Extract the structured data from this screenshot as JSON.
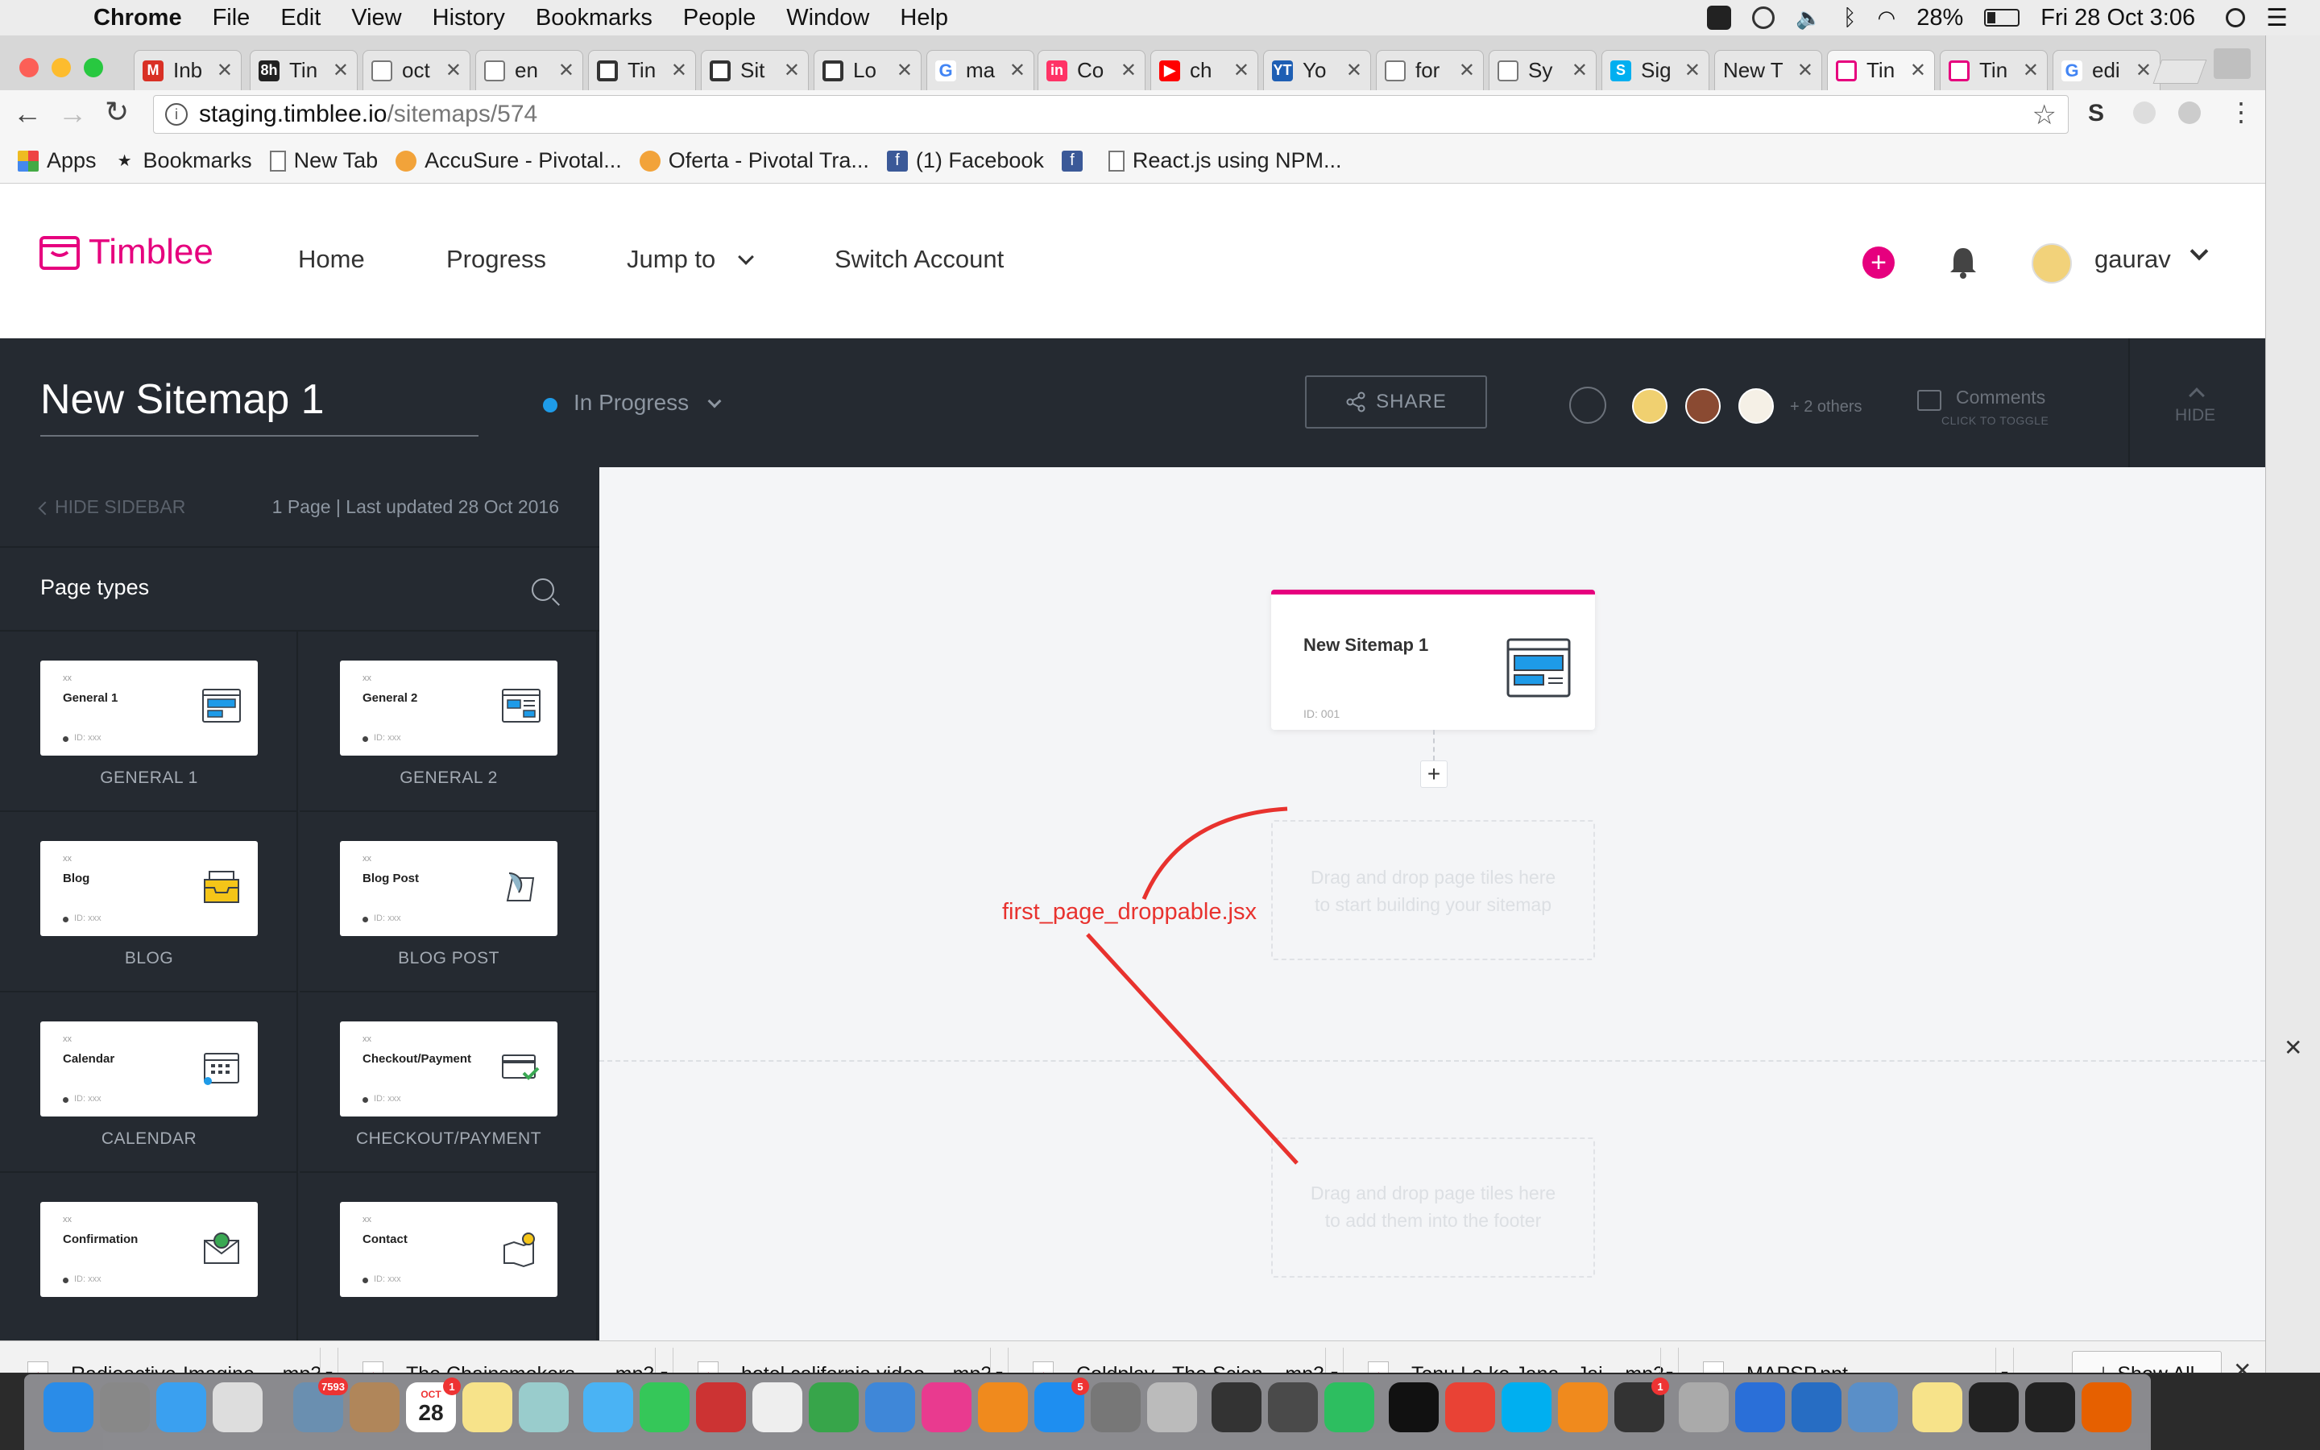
{
  "menubar": {
    "app": "Chrome",
    "items": [
      "File",
      "Edit",
      "View",
      "History",
      "Bookmarks",
      "People",
      "Window",
      "Help"
    ],
    "battery": "28%",
    "clock": "Fri 28 Oct  3:06"
  },
  "tabs": [
    {
      "label": "Inb",
      "icon": "gmail-icon",
      "color": "#d93025",
      "glyph": "M"
    },
    {
      "label": "Tin",
      "icon": "circle-badge-icon",
      "color": "#222222",
      "glyph": "8h"
    },
    {
      "label": "oct",
      "icon": "document-icon",
      "color": "#888888",
      "glyph": ""
    },
    {
      "label": "en",
      "icon": "document-icon",
      "color": "#888888",
      "glyph": ""
    },
    {
      "label": "Tin",
      "icon": "trello-icon",
      "color": "#333333",
      "glyph": ""
    },
    {
      "label": "Sit",
      "icon": "trello-icon",
      "color": "#333333",
      "glyph": ""
    },
    {
      "label": "Lo",
      "icon": "trello-icon",
      "color": "#333333",
      "glyph": ""
    },
    {
      "label": "ma",
      "icon": "google-icon",
      "color": "#4285f4",
      "glyph": "G"
    },
    {
      "label": "Co",
      "icon": "invision-icon",
      "color": "#ff3366",
      "glyph": "in"
    },
    {
      "label": "ch",
      "icon": "youtube-icon",
      "color": "#ff0000",
      "glyph": "▶"
    },
    {
      "label": "Yo",
      "icon": "ytmp3-icon",
      "color": "#1e5fb4",
      "glyph": "YT"
    },
    {
      "label": "for",
      "icon": "document-icon",
      "color": "#888888",
      "glyph": ""
    },
    {
      "label": "Sy",
      "icon": "document-icon",
      "color": "#888888",
      "glyph": ""
    },
    {
      "label": "Sig",
      "icon": "skype-icon",
      "color": "#00aff0",
      "glyph": "S"
    },
    {
      "label": "New T",
      "icon": "none",
      "color": "#e6e6e6",
      "glyph": ""
    },
    {
      "label": "Tin",
      "icon": "timblee-icon",
      "color": "#e6007e",
      "glyph": ""
    },
    {
      "label": "Tin",
      "icon": "timblee-icon",
      "color": "#e6007e",
      "glyph": ""
    },
    {
      "label": "edi",
      "icon": "google-icon",
      "color": "#4285f4",
      "glyph": "G"
    }
  ],
  "omnibox": {
    "host": "staging.timblee.io",
    "path": "/sitemaps/574"
  },
  "bookmarks": [
    {
      "label": "Apps",
      "icon": "apps-grid-icon"
    },
    {
      "label": "Bookmarks",
      "icon": "star-icon"
    },
    {
      "label": "New Tab",
      "icon": "document-icon"
    },
    {
      "label": "AccuSure - Pivotal...",
      "icon": "pivotal-icon"
    },
    {
      "label": "Oferta - Pivotal Tra...",
      "icon": "pivotal-icon"
    },
    {
      "label": "(1) Facebook",
      "icon": "facebook-icon"
    },
    {
      "label": "",
      "icon": "facebook-icon"
    },
    {
      "label": "React.js using NPM...",
      "icon": "document-icon"
    }
  ],
  "app": {
    "brand": "Timblee",
    "brand_color": "#e6007e",
    "nav": {
      "home": "Home",
      "progress": "Progress",
      "jump_to": "Jump to",
      "switch_account": "Switch Account"
    },
    "user": "gaurav"
  },
  "sitemap_bar": {
    "title": "New Sitemap 1",
    "status": "In Progress",
    "status_color": "#1e9be8",
    "share": "SHARE",
    "others": "+ 2 others",
    "comments": "Comments",
    "comments_sub": "CLICK TO TOGGLE",
    "hide": "HIDE"
  },
  "sidebar": {
    "hide": "HIDE SIDEBAR",
    "meta": "1 Page | Last updated 28 Oct 2016",
    "page_types_title": "Page types",
    "card_xx": "xx",
    "card_id": "ID: xxx",
    "types": [
      {
        "name": "General 1",
        "label": "GENERAL 1",
        "icon": "layout-window-icon"
      },
      {
        "name": "General 2",
        "label": "GENERAL 2",
        "icon": "layout-columns-icon"
      },
      {
        "name": "Blog",
        "label": "BLOG",
        "icon": "inbox-tray-icon"
      },
      {
        "name": "Blog Post",
        "label": "BLOG POST",
        "icon": "quill-scroll-icon"
      },
      {
        "name": "Calendar",
        "label": "CALENDAR",
        "icon": "calendar-icon"
      },
      {
        "name": "Checkout/Payment",
        "label": "CHECKOUT/PAYMENT",
        "icon": "credit-card-check-icon"
      },
      {
        "name": "Confirmation",
        "label": "",
        "icon": "envelope-check-icon"
      },
      {
        "name": "Contact",
        "label": "",
        "icon": "map-pin-icon"
      }
    ]
  },
  "canvas": {
    "root_tile": {
      "title": "New Sitemap 1",
      "id": "ID: 001"
    },
    "drop_main": [
      "Drag and drop page tiles here",
      "to start building your sitemap"
    ],
    "drop_footer": [
      "Drag and drop page tiles here",
      "to add them into the footer"
    ],
    "annotation": "first_page_droppable.jsx",
    "annotation_color": "#e8322e"
  },
  "downloads": {
    "items": [
      "Radioactive-Imagine ....mp3",
      "The Chainsmokers - ....mp3",
      "hotel california video ....mp3",
      "Coldplay - The Scien....mp3",
      "Tenu Le ke Jana - Jai....mp3",
      "MAPSP.ppt"
    ],
    "show_all": "Show All"
  },
  "dock": {
    "calendar_month": "OCT",
    "calendar_day": "28",
    "badges": {
      "photos": "7593",
      "calendar": "1",
      "appstore": "5",
      "skype": "1"
    }
  }
}
